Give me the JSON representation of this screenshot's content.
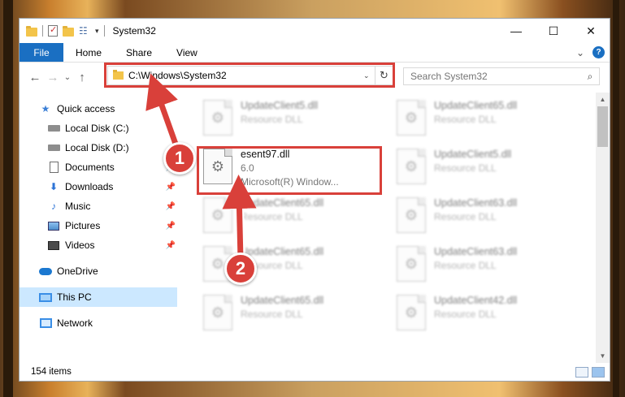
{
  "window": {
    "title": "System32"
  },
  "window_buttons": {
    "minimize": "—",
    "maximize": "☐",
    "close": "✕"
  },
  "ribbon": {
    "tabs": [
      "File",
      "Home",
      "Share",
      "View"
    ],
    "help": "?",
    "expand": "⌄"
  },
  "nav": {
    "back": "←",
    "forward": "→",
    "recent": "⌄",
    "up": "↑"
  },
  "address": {
    "path": "C:\\Windows\\System32",
    "chevron": "⌄",
    "refresh": "↻"
  },
  "search": {
    "placeholder": "Search System32",
    "icon": "search-icon"
  },
  "sidebar": {
    "items": [
      {
        "label": "Quick access",
        "icon": "star-icon",
        "pinned": false
      },
      {
        "label": "Local Disk (C:)",
        "icon": "drive-icon",
        "pinned": false
      },
      {
        "label": "Local Disk (D:)",
        "icon": "drive-icon",
        "pinned": false
      },
      {
        "label": "Documents",
        "icon": "documents-icon",
        "pinned": true
      },
      {
        "label": "Downloads",
        "icon": "downloads-icon",
        "pinned": true
      },
      {
        "label": "Music",
        "icon": "music-icon",
        "pinned": true
      },
      {
        "label": "Pictures",
        "icon": "pictures-icon",
        "pinned": true
      },
      {
        "label": "Videos",
        "icon": "videos-icon",
        "pinned": true
      },
      {
        "label": "OneDrive",
        "icon": "onedrive-icon",
        "pinned": false
      },
      {
        "label": "This PC",
        "icon": "this-pc-icon",
        "pinned": false,
        "selected": true
      },
      {
        "label": "Network",
        "icon": "network-icon",
        "pinned": false
      }
    ],
    "pin_glyph": "📌"
  },
  "files": [
    {
      "name": "UpdateClient5.dll",
      "type": "Resource DLL",
      "blurred": true
    },
    {
      "name": "UpdateClient65.dll",
      "type": "Resource DLL",
      "blurred": true
    },
    {
      "name": "esent97.dll",
      "type": "6.0",
      "desc": "Microsoft(R) Window...",
      "blurred": false
    },
    {
      "name": "UpdateClient5.dll",
      "type": "Resource DLL",
      "blurred": true
    },
    {
      "name": "UpdateClient65.dll",
      "type": "Resource DLL",
      "blurred": true
    },
    {
      "name": "UpdateClient63.dll",
      "type": "Resource DLL",
      "blurred": true
    },
    {
      "name": "UpdateClient65.dll",
      "type": "Resource DLL",
      "blurred": true
    },
    {
      "name": "UpdateClient63.dll",
      "type": "Resource DLL",
      "blurred": true
    },
    {
      "name": "UpdateClient65.dll",
      "type": "Resource DLL",
      "blurred": true
    },
    {
      "name": "UpdateClient42.dll",
      "type": "Resource DLL",
      "blurred": true
    }
  ],
  "status": {
    "items_count": "154 items"
  },
  "callouts": {
    "one": "1",
    "two": "2"
  },
  "colors": {
    "accent": "#1a6fc2",
    "highlight_red": "#d9403a",
    "selection": "#cce8ff"
  }
}
